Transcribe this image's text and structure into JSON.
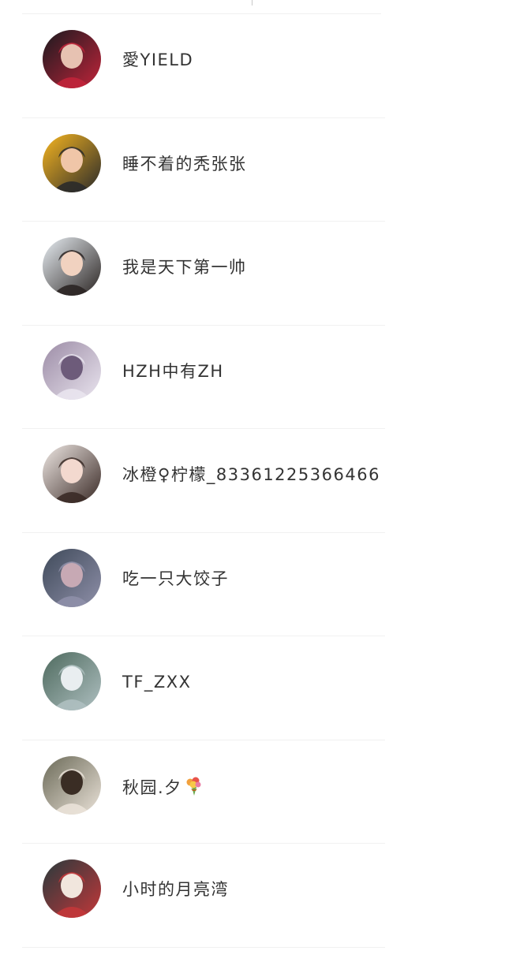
{
  "contacts": [
    {
      "name": "愛YIELD",
      "avatar": "avatar-woman-red-dress",
      "colors": [
        "#1a1a1f",
        "#c0243a",
        "#e7c2b2"
      ]
    },
    {
      "name": "睡不着的秃张张",
      "avatar": "avatar-boy-yellow-hood",
      "colors": [
        "#f6b520",
        "#2a2a2a",
        "#f0c6a8"
      ]
    },
    {
      "name": "我是天下第一帅",
      "avatar": "avatar-boy-light-bg",
      "colors": [
        "#e8eef3",
        "#2b2523",
        "#f1d2c0"
      ]
    },
    {
      "name": "HZH中有ZH",
      "avatar": "avatar-boy-cap",
      "colors": [
        "#9c8ca6",
        "#e9e4ee",
        "#6d5b7a"
      ]
    },
    {
      "name": "冰橙♀柠檬_83361225366466",
      "avatar": "avatar-girl-light",
      "colors": [
        "#efe8e4",
        "#3a2a26",
        "#f3d9cf"
      ]
    },
    {
      "name": "吃一只大饺子",
      "avatar": "avatar-starry-sky",
      "colors": [
        "#3f4a5a",
        "#8e8fa8",
        "#c7a9b4"
      ]
    },
    {
      "name": "TF_ZXX",
      "avatar": "avatar-trees-figure",
      "colors": [
        "#4e6a5e",
        "#aebfc0",
        "#e9eef0"
      ]
    },
    {
      "name": "秋园.夕",
      "avatar": "avatar-girl-outdoor",
      "colors": [
        "#6b6a58",
        "#eae2d8",
        "#3a2d24"
      ],
      "emoji": "bouquet-icon"
    },
    {
      "name": "小时的月亮湾",
      "avatar": "avatar-red-hair-girl",
      "colors": [
        "#283a3c",
        "#c2373a",
        "#f1e6dd"
      ]
    }
  ]
}
